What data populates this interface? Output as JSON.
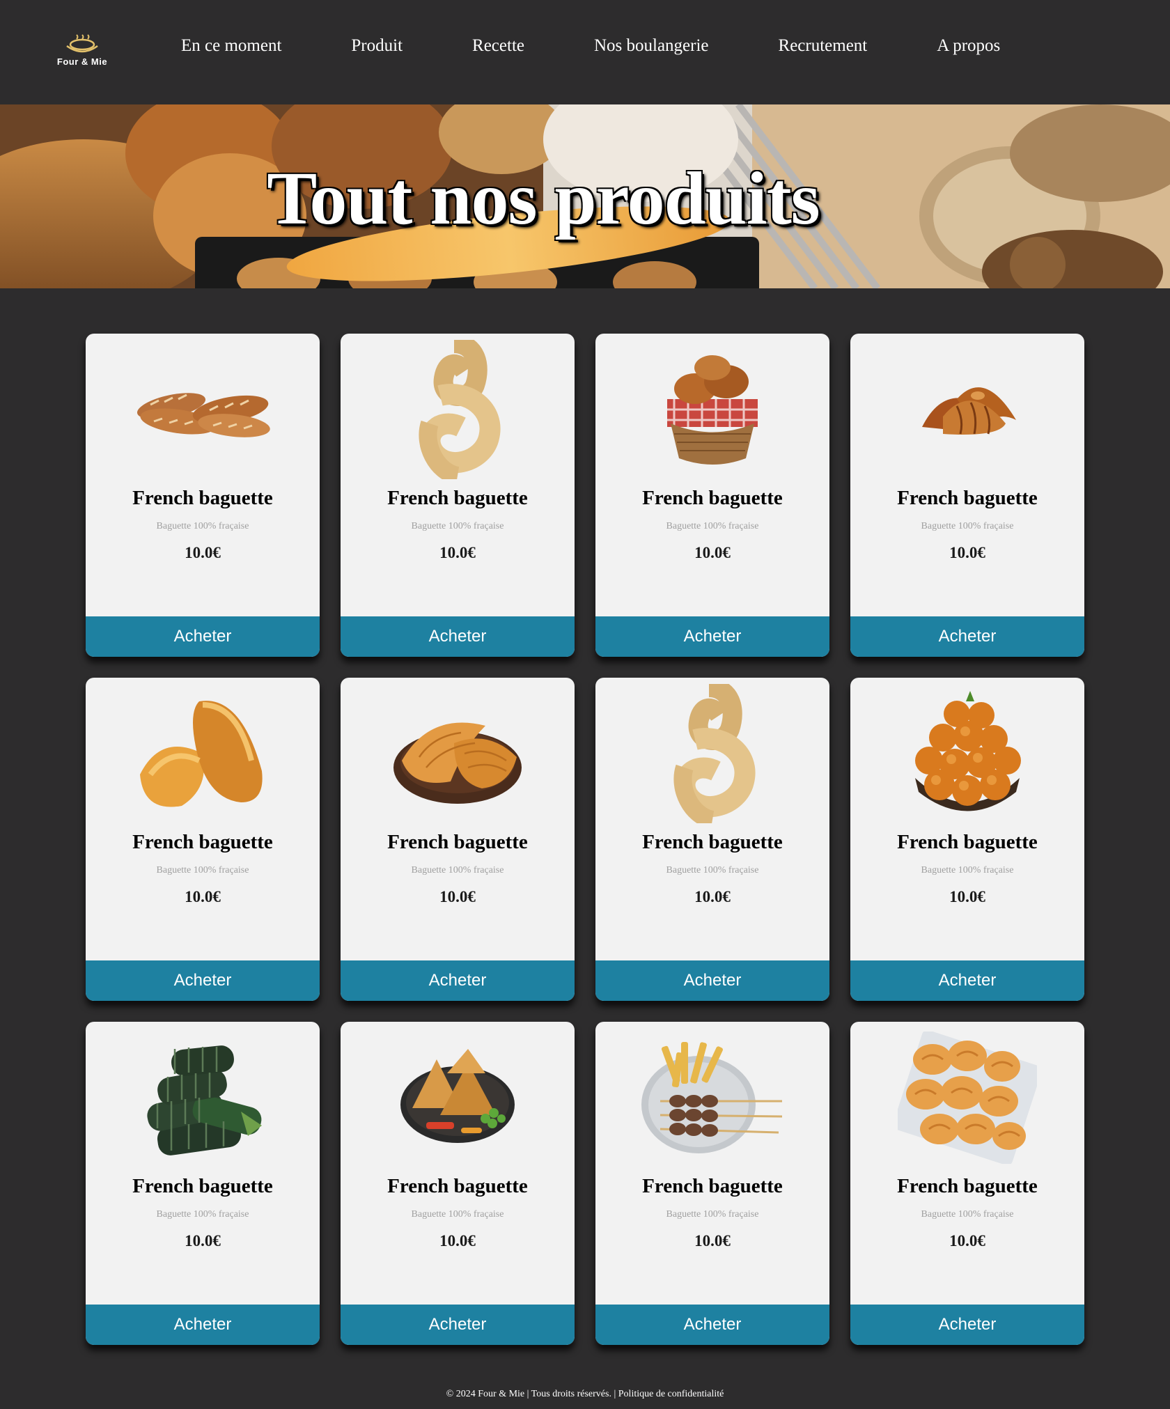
{
  "brand": {
    "name": "Four & Mie"
  },
  "nav": {
    "items": [
      {
        "label": "En ce moment"
      },
      {
        "label": "Produit"
      },
      {
        "label": "Recette"
      },
      {
        "label": "Nos boulangerie"
      },
      {
        "label": "Recrutement"
      },
      {
        "label": "A propos"
      }
    ]
  },
  "hero": {
    "title": "Tout nos produits"
  },
  "products": [
    {
      "name": "French baguette",
      "description": "Baguette 100% fraçaise",
      "price": "10.0€",
      "button": "Acheter",
      "image": "baguettes-image"
    },
    {
      "name": "French baguette",
      "description": "Baguette 100% fraçaise",
      "price": "10.0€",
      "button": "Acheter",
      "image": "knotted-bread-image"
    },
    {
      "name": "French baguette",
      "description": "Baguette 100% fraçaise",
      "price": "10.0€",
      "button": "Acheter",
      "image": "pastry-basket-image"
    },
    {
      "name": "French baguette",
      "description": "Baguette 100% fraçaise",
      "price": "10.0€",
      "button": "Acheter",
      "image": "croissants-image"
    },
    {
      "name": "French baguette",
      "description": "Baguette 100% fraçaise",
      "price": "10.0€",
      "button": "Acheter",
      "image": "madeleines-image"
    },
    {
      "name": "French baguette",
      "description": "Baguette 100% fraçaise",
      "price": "10.0€",
      "button": "Acheter",
      "image": "pithivier-pie-image"
    },
    {
      "name": "French baguette",
      "description": "Baguette 100% fraçaise",
      "price": "10.0€",
      "button": "Acheter",
      "image": "knotted-bread-image"
    },
    {
      "name": "French baguette",
      "description": "Baguette 100% fraçaise",
      "price": "10.0€",
      "button": "Acheter",
      "image": "fried-dough-balls-image"
    },
    {
      "name": "French baguette",
      "description": "Baguette 100% fraçaise",
      "price": "10.0€",
      "button": "Acheter",
      "image": "leaf-wraps-image"
    },
    {
      "name": "French baguette",
      "description": "Baguette 100% fraçaise",
      "price": "10.0€",
      "button": "Acheter",
      "image": "samosas-image"
    },
    {
      "name": "French baguette",
      "description": "Baguette 100% fraçaise",
      "price": "10.0€",
      "button": "Acheter",
      "image": "brochettes-image"
    },
    {
      "name": "French baguette",
      "description": "Baguette 100% fraçaise",
      "price": "10.0€",
      "button": "Acheter",
      "image": "palmiers-image"
    }
  ],
  "footer": {
    "text": "© 2024 Four & Mie | Tous droits réservés. | Politique de confidentialité"
  },
  "colors": {
    "background": "#2d2c2d",
    "card": "#f2f2f2",
    "button": "#1e81a1"
  }
}
